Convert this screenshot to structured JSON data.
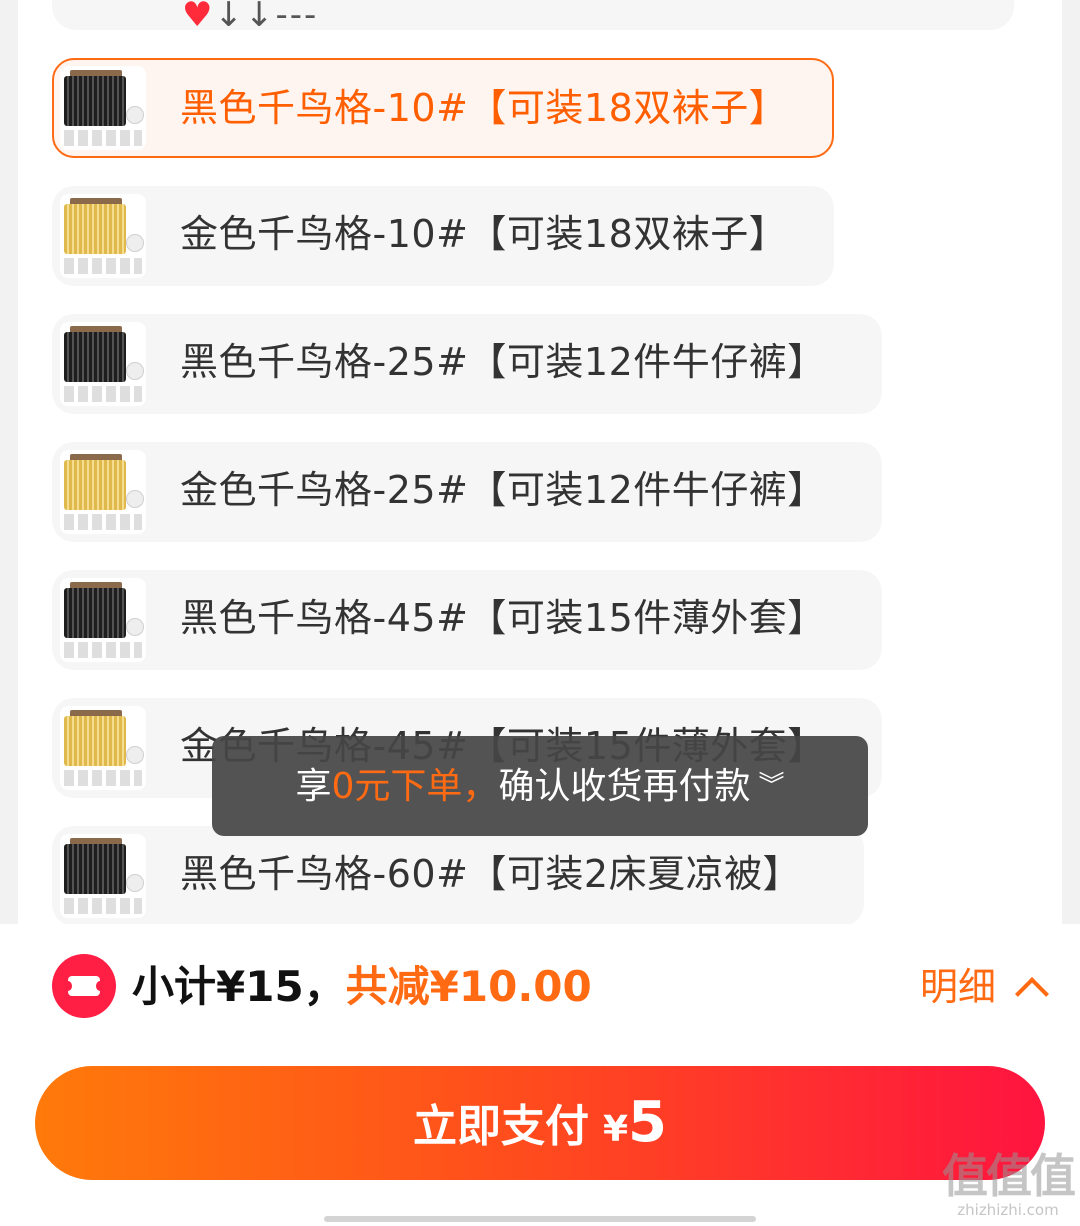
{
  "top_row": {
    "icons": [
      "heart-icon",
      "arrow-down-icon",
      "arrow-down-icon",
      "dash-icon"
    ]
  },
  "sku_options": [
    {
      "label": "黑色千鸟格-10#【可装18双袜子】",
      "selected": true,
      "color": "black"
    },
    {
      "label": "金色千鸟格-10#【可装18双袜子】",
      "selected": false,
      "color": "gold"
    },
    {
      "label": "黑色千鸟格-25#【可装12件牛仔裤】",
      "selected": false,
      "color": "black"
    },
    {
      "label": "金色千鸟格-25#【可装12件牛仔裤】",
      "selected": false,
      "color": "gold"
    },
    {
      "label": "黑色千鸟格-45#【可装15件薄外套】",
      "selected": false,
      "color": "black"
    },
    {
      "label": "金色千鸟格-45#【可装15件薄外套】",
      "selected": false,
      "color": "gold"
    },
    {
      "label": "黑色千鸟格-60#【可装2床夏凉被】",
      "selected": false,
      "color": "black"
    }
  ],
  "toast": {
    "prefix": "享",
    "highlight": "0元下单，",
    "suffix": "确认收货再付款",
    "chevron": "»"
  },
  "footer": {
    "subtotal": "小计¥15，",
    "discount": "共减¥10.00",
    "detail_label": "明细"
  },
  "pay_button": {
    "label": "立即支付",
    "currency": "¥",
    "amount": "5"
  },
  "watermark": {
    "logo": "值值值",
    "url": "zhizhizhi.com"
  },
  "colors": {
    "accent": "#ff6a13",
    "selected_border": "#ff6a13",
    "coupon_red": "#ff1f45",
    "button_gradient_start": "#ff7a0a",
    "button_gradient_end": "#ff1440"
  }
}
